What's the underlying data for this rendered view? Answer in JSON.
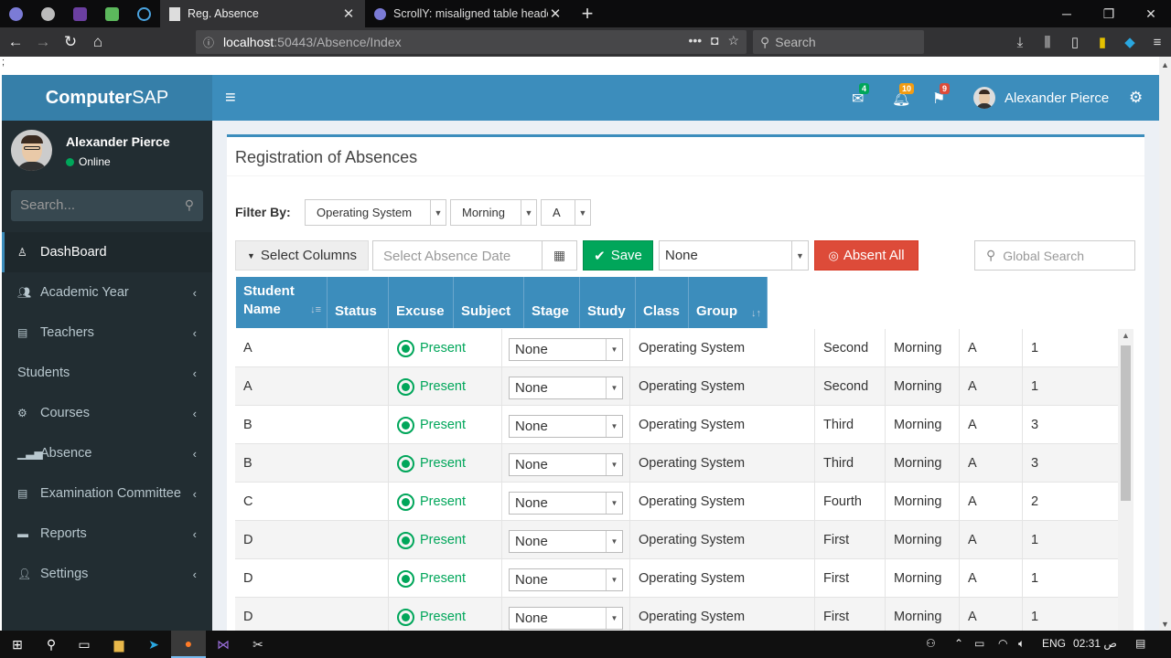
{
  "browser": {
    "tabs": [
      {
        "title": "Reg. Absence",
        "active": true
      },
      {
        "title": "ScrollY: misaligned table heade",
        "active": false
      }
    ],
    "url_host": "localhost",
    "url_path": ":50443/Absence/Index",
    "search_placeholder": "Search",
    "page_stub": ";"
  },
  "app": {
    "logo_bold": "Computer",
    "logo_rest": "SAP",
    "header": {
      "mail_count": "4",
      "bell_count": "10",
      "flag_count": "9",
      "user_name": "Alexander Pierce",
      "colors": {
        "mail": "#00a65a",
        "bell": "#f39c12",
        "flag": "#dd4b39"
      }
    },
    "sidebar": {
      "user_name": "Alexander Pierce",
      "status": "Online",
      "search_placeholder": "Search...",
      "items": [
        {
          "label": "DashBoard",
          "icon": "dashboard-icon"
        },
        {
          "label": "Academic Year",
          "icon": "users-icon"
        },
        {
          "label": "Teachers",
          "icon": "book-icon"
        },
        {
          "label": "Students",
          "icon": ""
        },
        {
          "label": "Courses",
          "icon": "gear-icon"
        },
        {
          "label": "Absence",
          "icon": "bar-chart-icon"
        },
        {
          "label": "Examination Committee",
          "icon": "list-icon"
        },
        {
          "label": "Reports",
          "icon": "folder-icon"
        },
        {
          "label": "Settings",
          "icon": "user-settings-icon"
        }
      ]
    },
    "main": {
      "title": "Registration of Absences",
      "filter_label": "Filter By:",
      "filters": [
        "Operating System",
        "Morning",
        "A"
      ],
      "select_columns": "Select Columns",
      "date_placeholder": "Select Absence Date",
      "save": "Save",
      "excuse_select": "None",
      "absent_all": "Absent All",
      "global_search_placeholder": "Global Search",
      "columns": [
        "Student\nName",
        "Status",
        "Excuse",
        "Subject",
        "Stage",
        "Study",
        "Class",
        "Group"
      ],
      "rows": [
        {
          "name": "A",
          "status": "Present",
          "excuse": "None",
          "subject": "Operating System",
          "stage": "Second",
          "study": "Morning",
          "class": "A",
          "group": "1"
        },
        {
          "name": "A",
          "status": "Present",
          "excuse": "None",
          "subject": "Operating System",
          "stage": "Second",
          "study": "Morning",
          "class": "A",
          "group": "1"
        },
        {
          "name": "B",
          "status": "Present",
          "excuse": "None",
          "subject": "Operating System",
          "stage": "Third",
          "study": "Morning",
          "class": "A",
          "group": "3"
        },
        {
          "name": "B",
          "status": "Present",
          "excuse": "None",
          "subject": "Operating System",
          "stage": "Third",
          "study": "Morning",
          "class": "A",
          "group": "3"
        },
        {
          "name": "C",
          "status": "Present",
          "excuse": "None",
          "subject": "Operating System",
          "stage": "Fourth",
          "study": "Morning",
          "class": "A",
          "group": "2"
        },
        {
          "name": "D",
          "status": "Present",
          "excuse": "None",
          "subject": "Operating System",
          "stage": "First",
          "study": "Morning",
          "class": "A",
          "group": "1"
        },
        {
          "name": "D",
          "status": "Present",
          "excuse": "None",
          "subject": "Operating System",
          "stage": "First",
          "study": "Morning",
          "class": "A",
          "group": "1"
        },
        {
          "name": "D",
          "status": "Present",
          "excuse": "None",
          "subject": "Operating System",
          "stage": "First",
          "study": "Morning",
          "class": "A",
          "group": "1"
        }
      ]
    }
  },
  "taskbar": {
    "lang": "ENG",
    "time": "02:31 ص"
  }
}
